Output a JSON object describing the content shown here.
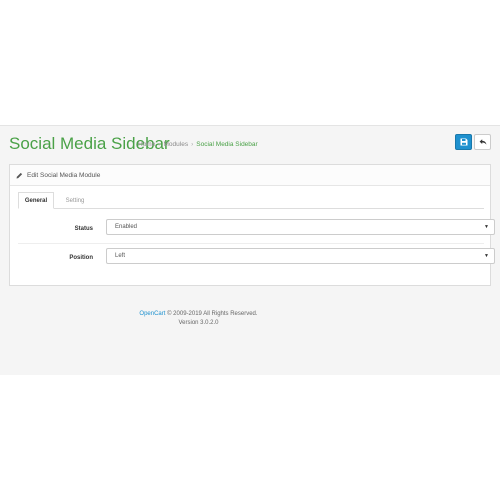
{
  "header": {
    "title": "Social Media Sidebar",
    "breadcrumb": [
      "Home",
      "Modules",
      "Social Media Sidebar"
    ],
    "breadcrumb_separator": "›"
  },
  "toolbar": {
    "save_icon": "save-icon",
    "back_icon": "reply-icon"
  },
  "panel": {
    "heading": "Edit Social Media Module",
    "heading_icon": "pencil-icon"
  },
  "tabs": [
    {
      "label": "General",
      "active": true
    },
    {
      "label": "Setting",
      "active": false
    }
  ],
  "form": {
    "status": {
      "label": "Status",
      "value": "Enabled"
    },
    "position": {
      "label": "Position",
      "value": "Left"
    }
  },
  "footer": {
    "brand": "OpenCart",
    "copyright": "© 2009-2019 All Rights Reserved.",
    "version": "Version 3.0.2.0"
  },
  "colors": {
    "accent_green": "#4aa147",
    "primary_blue": "#1e91cf"
  }
}
